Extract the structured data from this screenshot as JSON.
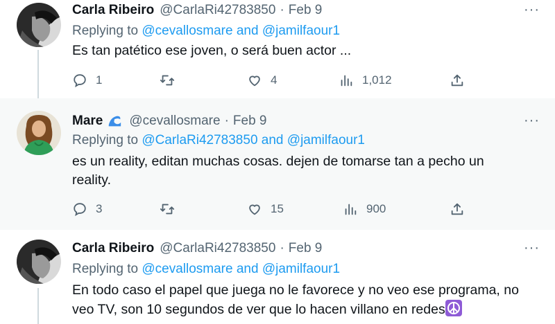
{
  "tweets": [
    {
      "name": "Carla Ribeiro",
      "handle": "@CarlaRi42783850",
      "date": "Feb 9",
      "replying_prefix": "Replying to ",
      "replying_a": "@cevallosmare",
      "replying_and": " and ",
      "replying_b": "@jamilfaour1",
      "text": "Es tan patético ese joven, o será buen actor ...",
      "replies": "1",
      "retweets": "",
      "likes": "4",
      "views": "1,012"
    },
    {
      "name": "Mare",
      "handle": "@cevallosmare",
      "date": "Feb 9",
      "replying_prefix": "Replying to ",
      "replying_a": "@CarlaRi42783850",
      "replying_and": " and ",
      "replying_b": "@jamilfaour1",
      "text": "es un reality, editan muchas cosas. dejen de tomarse tan a pecho un reality.",
      "replies": "3",
      "retweets": "",
      "likes": "15",
      "views": "900"
    },
    {
      "name": "Carla Ribeiro",
      "handle": "@CarlaRi42783850",
      "date": "Feb 9",
      "replying_prefix": "Replying to ",
      "replying_a": "@cevallosmare",
      "replying_and": " and ",
      "replying_b": "@jamilfaour1",
      "text": "En todo caso el papel que juega no le favorece y no veo ese programa, no veo TV, son 10 segundos de ver que lo hacen villano en redes"
    }
  ],
  "separator": "·",
  "more_glyph": "···",
  "icons": {
    "reply": "reply-icon",
    "retweet": "retweet-icon",
    "like": "heart-icon",
    "views": "views-icon",
    "share": "share-icon",
    "wave_emoji": "wave-emoji",
    "peace_emoji": "peace-emoji"
  },
  "colors": {
    "link": "#1d9bf0",
    "secondary": "#536471",
    "highlight_bg": "#f7f9f9",
    "thread_line": "#cfd9de"
  }
}
